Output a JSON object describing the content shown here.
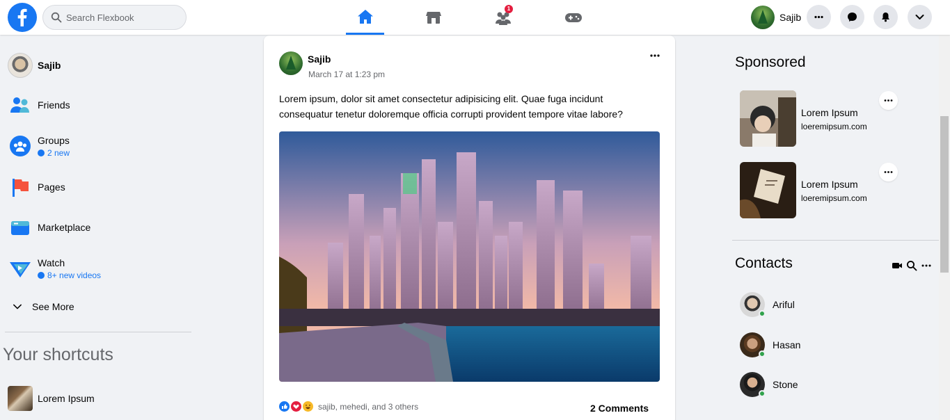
{
  "header": {
    "search_placeholder": "Search Flexbook",
    "friends_badge": "1",
    "profile_name": "Sajib"
  },
  "left_sidebar": {
    "user_name": "Sajib",
    "items": [
      {
        "label": "Friends"
      },
      {
        "label": "Groups",
        "sub": "2 new"
      },
      {
        "label": "Pages"
      },
      {
        "label": "Marketplace"
      },
      {
        "label": "Watch",
        "sub": "8+ new videos"
      }
    ],
    "see_more": "See More",
    "shortcuts_title": "Your shortcuts",
    "shortcuts": [
      {
        "label": "Lorem Ipsum"
      }
    ]
  },
  "post": {
    "author": "Sajib",
    "time": "March 17 at 1:23 pm",
    "text": "Lorem ipsum, dolor sit amet consectetur adipisicing elit. Quae fuga incidunt consequatur tenetur doloremque officia corrupti provident tempore vitae labore?",
    "reactions_text": "sajib, mehedi, and 3 others",
    "comments": "2 Comments"
  },
  "sponsored": {
    "title": "Sponsored",
    "items": [
      {
        "name": "Lorem Ipsum",
        "url": "loeremipsum.com"
      },
      {
        "name": "Lorem Ipsum",
        "url": "loeremipsum.com"
      }
    ]
  },
  "contacts": {
    "title": "Contacts",
    "list": [
      {
        "name": "Ariful"
      },
      {
        "name": "Hasan"
      },
      {
        "name": "Stone"
      }
    ]
  },
  "colors": {
    "brand": "#1877f2",
    "background": "#f0f2f5",
    "badge": "#e41e3f",
    "online": "#31a24c"
  }
}
